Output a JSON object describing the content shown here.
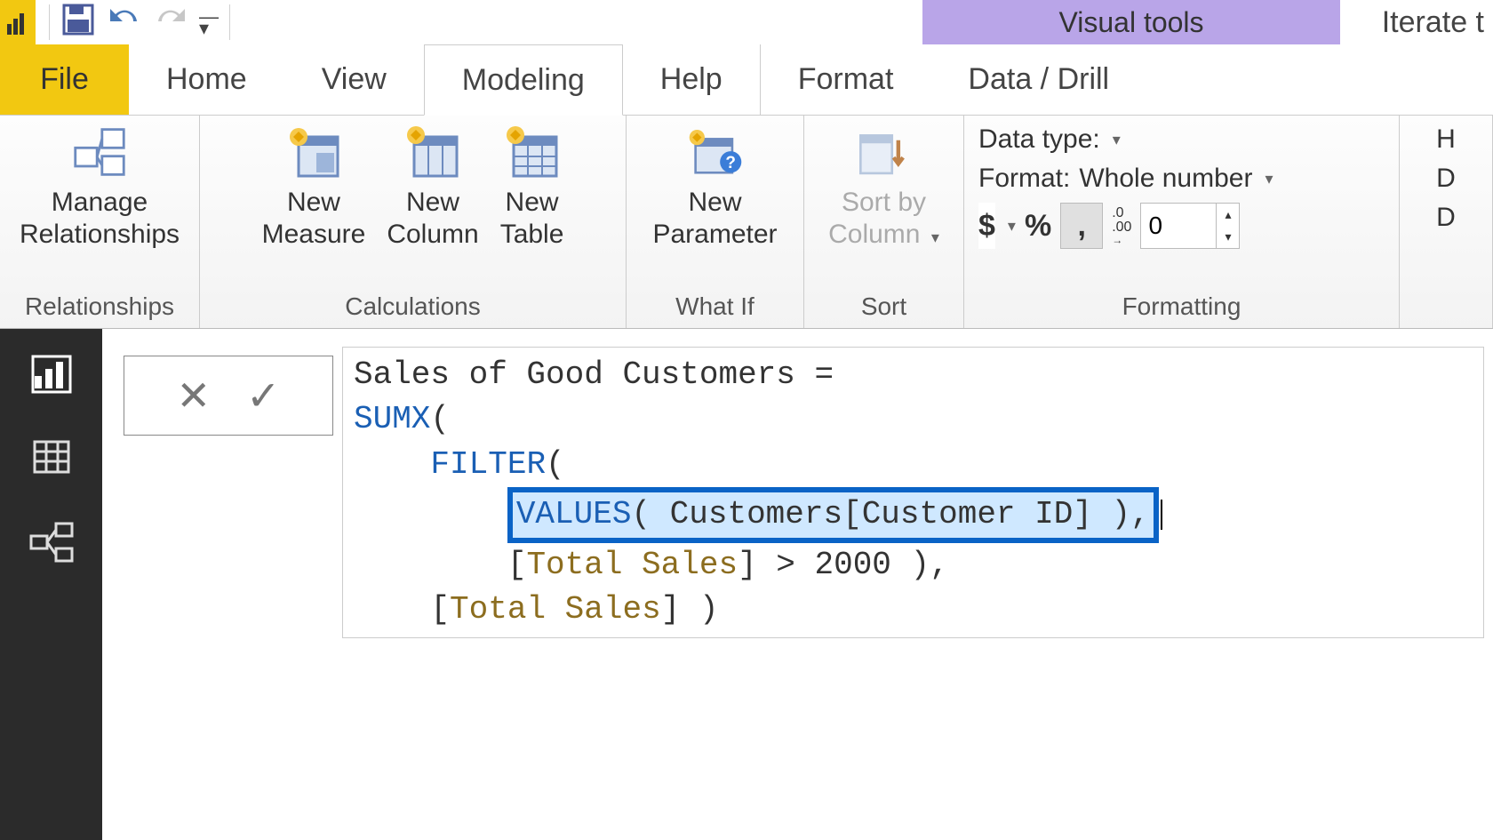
{
  "titlebar": {
    "visual_tools": "Visual tools",
    "document": "Iterate t"
  },
  "tabs": {
    "file": "File",
    "home": "Home",
    "view": "View",
    "modeling": "Modeling",
    "help": "Help",
    "format": "Format",
    "data_drill": "Data / Drill"
  },
  "ribbon": {
    "relationships": {
      "manage1": "Manage",
      "manage2": "Relationships",
      "group": "Relationships"
    },
    "calculations": {
      "new_measure1": "New",
      "new_measure2": "Measure",
      "new_column1": "New",
      "new_column2": "Column",
      "new_table1": "New",
      "new_table2": "Table",
      "group": "Calculations"
    },
    "whatif": {
      "new_param1": "New",
      "new_param2": "Parameter",
      "group": "What If"
    },
    "sort": {
      "sortby1": "Sort by",
      "sortby2": "Column",
      "group": "Sort"
    },
    "formatting": {
      "data_type": "Data type:",
      "format_label": "Format:",
      "format_value": "Whole number",
      "currency": "$",
      "percent": "%",
      "thousand": ",",
      "decimal_icon_top": ".0",
      "decimal_icon_bot": ".00",
      "decimal_value": "0",
      "group": "Formatting",
      "right_h": "H",
      "right_d1": "D",
      "right_d2": "D"
    }
  },
  "formula_bar": {
    "cancel": "✕",
    "accept": "✓"
  },
  "formula": {
    "line1_plain": "Sales of Good Customers = ",
    "line2_fn": "SUMX",
    "line2_rest": "(",
    "line3_indent": "    ",
    "line3_fn": "FILTER",
    "line3_rest": "(",
    "line4_indent": "        ",
    "line4_fn": "VALUES",
    "line4_mid": "( Customers[Customer ID] )",
    "line4_trail": ",",
    "line5_indent": "        [",
    "line5_ident": "Total Sales",
    "line5_rest": "] > 2000 ),",
    "line6_indent": "    [",
    "line6_ident": "Total Sales",
    "line6_rest": "] )"
  },
  "bg_text": "Iter"
}
